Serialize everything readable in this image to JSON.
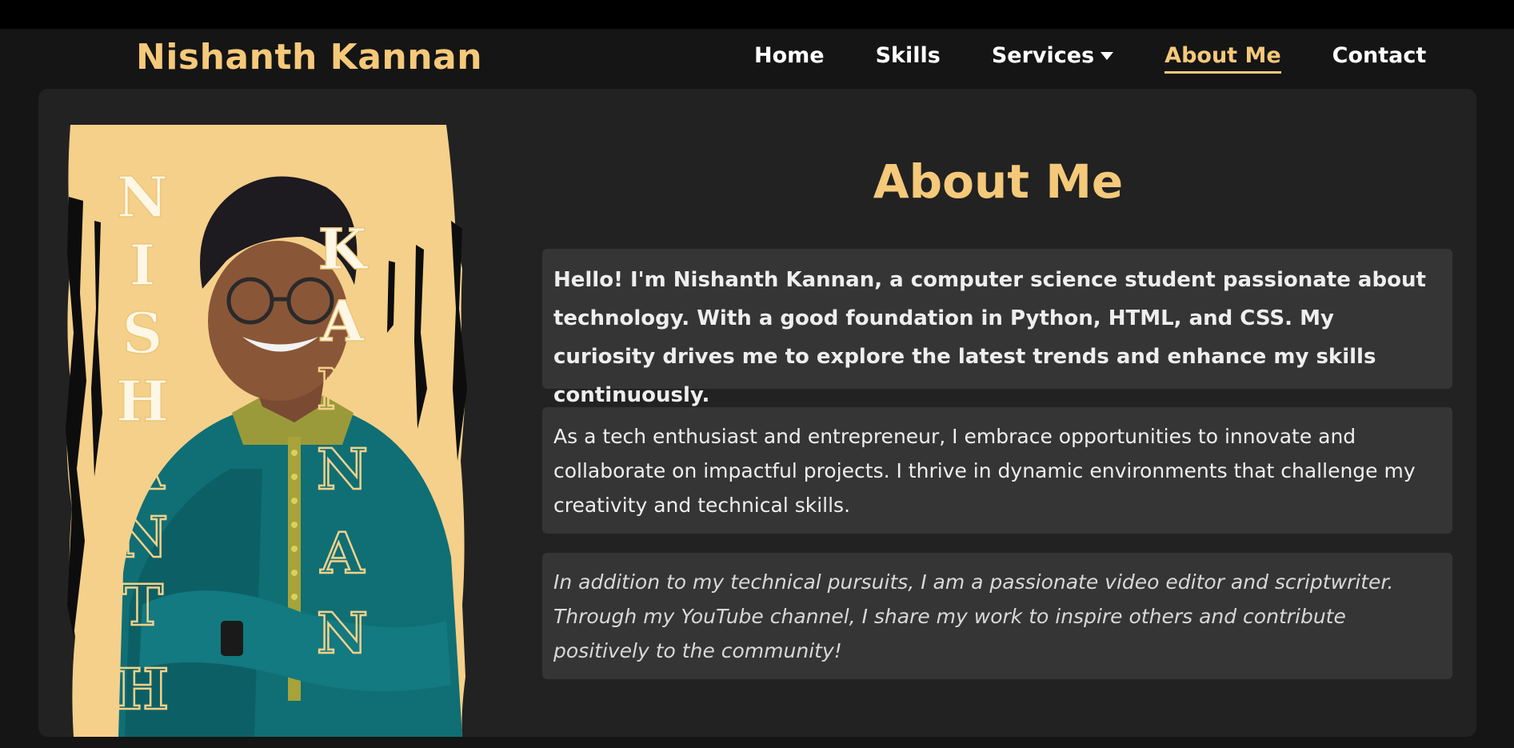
{
  "brand": {
    "name": "Nishanth Kannan"
  },
  "nav": {
    "items": [
      {
        "label": "Home"
      },
      {
        "label": "Skills"
      },
      {
        "label": "Services"
      },
      {
        "label": "About Me",
        "active": true
      },
      {
        "label": "Contact"
      }
    ]
  },
  "about": {
    "heading": "About Me",
    "paragraphs": [
      "Hello! I'm Nishanth Kannan, a computer science student passionate about technology. With a good foundation in Python, HTML, and CSS. My curiosity drives me to explore the latest trends and enhance my skills continuously.",
      "As a tech enthusiast and entrepreneur, I embrace opportunities to innovate and collaborate on impactful projects. I thrive in dynamic environments that challenge my creativity and technical skills.",
      "In addition to my technical pursuits, I am a passionate video editor and scriptwriter. Through my YouTube channel, I share my work to inspire others and contribute positively to the community!"
    ]
  },
  "photo": {
    "left_letters": [
      "N",
      "I",
      "S",
      "H",
      "A",
      "N",
      "T",
      "H"
    ],
    "right_letters": [
      "K",
      "A",
      "N",
      "N",
      "A",
      "N"
    ]
  },
  "colors": {
    "accent": "#f5c97a",
    "background": "#151515",
    "card": "#222222",
    "panel": "#353535"
  }
}
